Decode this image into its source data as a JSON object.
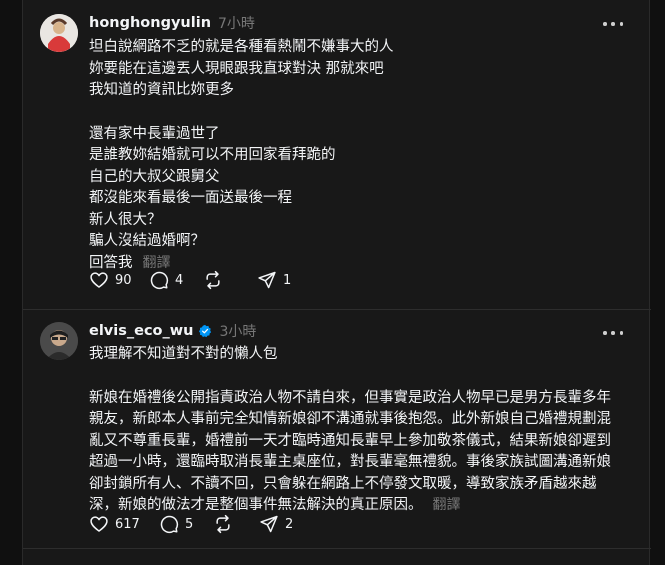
{
  "posts": [
    {
      "username": "honghongyulin",
      "time": "7小時",
      "verified": false,
      "lines": [
        "坦白說網路不乏的就是各種看熱鬧不嫌事大的人",
        "妳要能在這邊丟人現眼跟我直球對決 那就來吧",
        "我知道的資訊比妳更多",
        "",
        "還有家中長輩過世了",
        "是誰教妳結婚就可以不用回家看拜跪的",
        "自己的大叔父跟舅父",
        "都沒能來看最後一面送最後一程",
        "新人很大？",
        "騙人沒結過婚啊？",
        "回答我"
      ],
      "translate": "翻譯",
      "likes": "90",
      "comments": "4",
      "reposts": "",
      "shares": "1"
    },
    {
      "username": "elvis_eco_wu",
      "time": "3小時",
      "verified": true,
      "lines": [
        "我理解不知道對不對的懶人包",
        "",
        "新娘在婚禮後公開指責政治人物不請自來，但事實是政治人物早已是男方長輩多年",
        "親友，新郎本人事前完全知情新娘卻不溝通就事後抱怨。此外新娘自己婚禮規劃混",
        "亂又不尊重長輩，婚禮前一天才臨時通知長輩早上參加敬茶儀式，結果新娘卻遲到",
        "超過一小時，還臨時取消長輩主桌座位，對長輩毫無禮貌。事後家族試圖溝通新娘",
        "卻封鎖所有人、不讀不回，只會躲在網路上不停發文取暖，導致家族矛盾越來越",
        "深，新娘的做法才是整個事件無法解決的真正原因。"
      ],
      "translate": "翻譯",
      "likes": "617",
      "comments": "5",
      "reposts": "",
      "shares": "2"
    }
  ],
  "icons": {
    "like": "heart-icon",
    "comment": "comment-bubble-icon",
    "repost": "repost-icon",
    "share": "paper-plane-icon",
    "more": "more-dots-icon",
    "verified": "verified-badge-icon"
  },
  "colors": {
    "background": "#101010",
    "card": "#181818",
    "text": "#f3f5f7",
    "muted": "#777777",
    "verified": "#0095f6"
  }
}
